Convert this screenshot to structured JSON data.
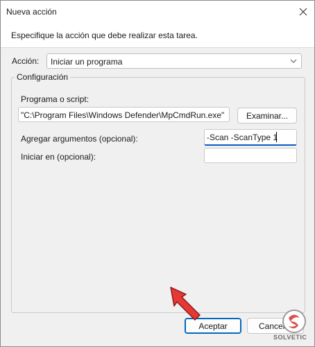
{
  "window": {
    "title": "Nueva acción"
  },
  "instruction": "Especifique la acción que debe realizar esta tarea.",
  "action": {
    "label": "Acción:",
    "selected": "Iniciar un programa"
  },
  "group": {
    "legend": "Configuración",
    "program": {
      "label": "Programa o script:",
      "value": "\"C:\\Program Files\\Windows Defender\\MpCmdRun.exe\"",
      "browse_label": "Examinar..."
    },
    "arguments": {
      "label": "Agregar argumentos (opcional):",
      "value": "-Scan -ScanType 1"
    },
    "start_in": {
      "label": "Iniciar en (opcional):",
      "value": ""
    }
  },
  "buttons": {
    "accept": "Aceptar",
    "cancel": "Cancelar"
  },
  "watermark": {
    "text": "SOLVETIC",
    "color": "#d9534f"
  },
  "colors": {
    "accent": "#0067c0",
    "arrow": "#e53935"
  }
}
